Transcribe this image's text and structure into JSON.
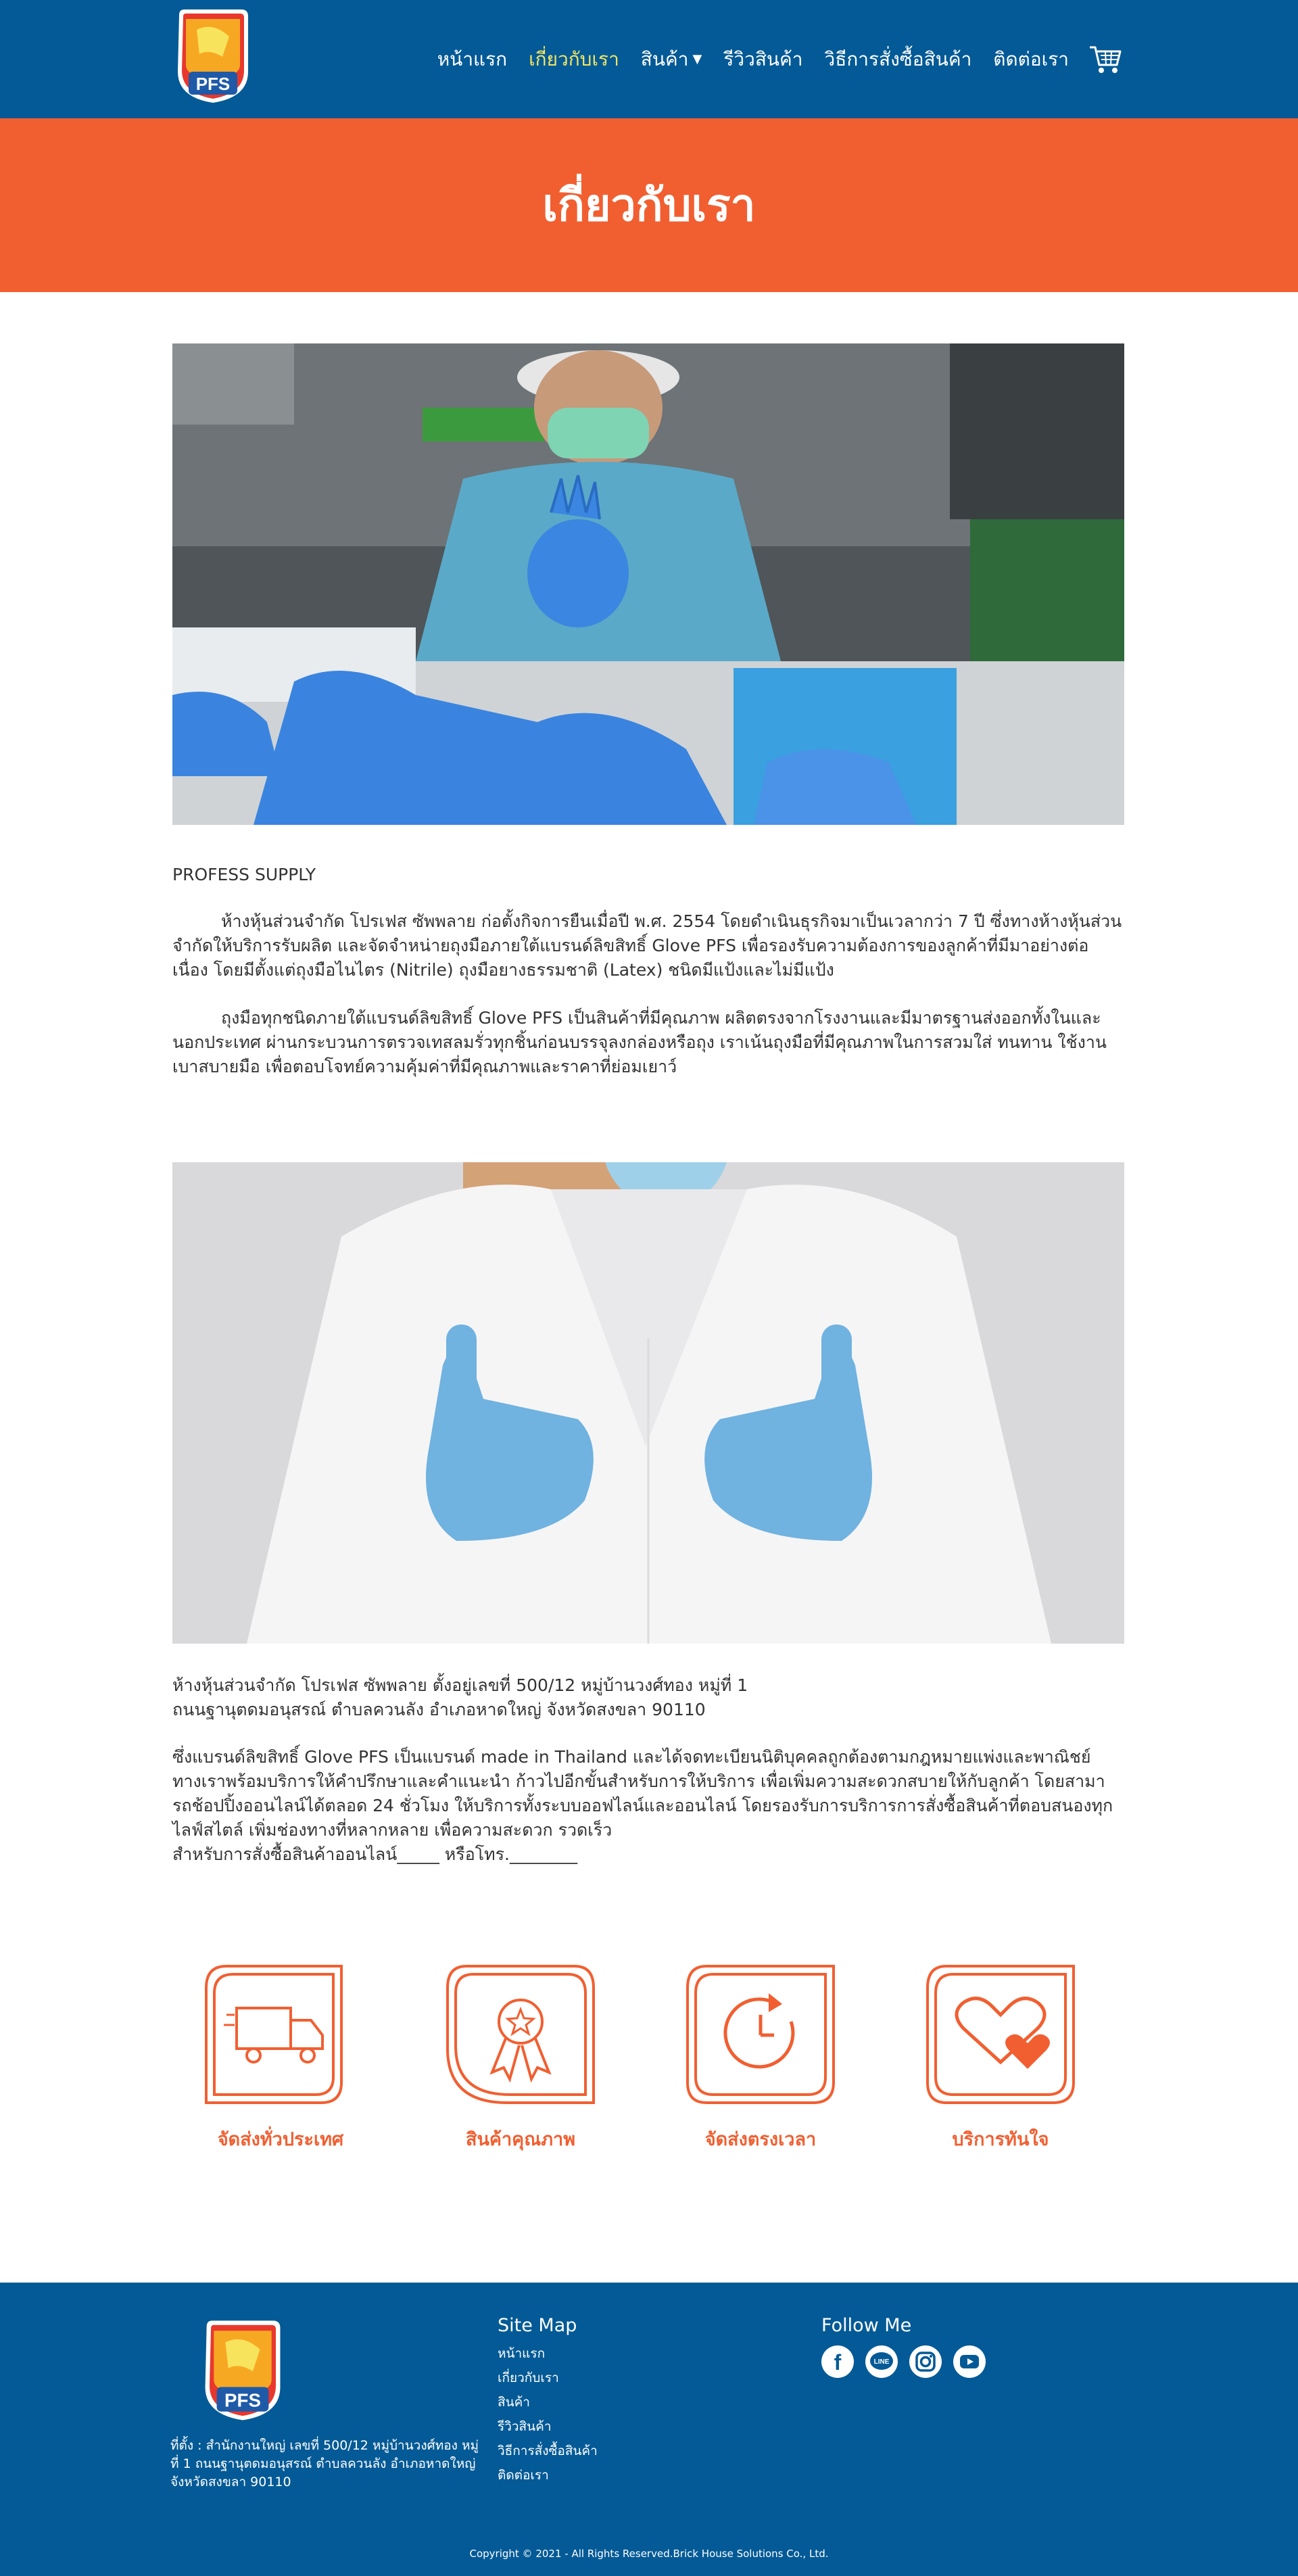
{
  "header": {
    "logo_text": "PFS",
    "nav": [
      {
        "label": "หน้าแรก",
        "active": false
      },
      {
        "label": "เกี่ยวกับเรา",
        "active": true
      },
      {
        "label": "สินค้า",
        "active": false,
        "dropdown": true
      },
      {
        "label": "รีวิวสินค้า",
        "active": false
      },
      {
        "label": "วิธีการสั่งซื้อสินค้า",
        "active": false
      },
      {
        "label": "ติดต่อเรา",
        "active": false
      }
    ],
    "cart_icon": "cart-icon"
  },
  "banner": {
    "title": "เกี่ยวกับเรา"
  },
  "content": {
    "brand_heading": "PROFESS SUPPLY",
    "paragraph1": "ห้างหุ้นส่วนจำกัด โปรเฟส ซัพพลาย ก่อตั้งกิจการยืนเมื่อปี พ.ศ. 2554 โดยดำเนินธุรกิจมาเป็นเวลากว่า 7 ปี ซึ่งทางห้างหุ้นส่วนจำกัดให้บริการรับผลิต และจัดจำหน่ายถุงมือภายใต้แบรนด์ลิขสิทธิ์ Glove PFS เพื่อรองรับความต้องการของลูกค้าที่มีมาอย่างต่อเนื่อง โดยมีตั้งแต่ถุงมือไนไตร (Nitrile) ถุงมือยางธรรมชาติ (Latex) ชนิดมีแป้งและไม่มีแป้ง",
    "paragraph2": "ถุงมือทุกชนิดภายใต้แบรนด์ลิขสิทธิ์ Glove PFS เป็นสินค้าที่มีคุณภาพ ผลิตตรงจากโรงงานและมีมาตรฐานส่งออกทั้งในและนอกประเทศ ผ่านกระบวนการตรวจเทสลมรั่วทุกชิ้นก่อนบรรจุลงกล่องหรือถุง เราเน้นถุงมือที่มีคุณภาพในการสวมใส่ ทนทาน ใช้งานเบาสบายมือ เพื่อตอบโจทย์ความคุ้มค่าที่มีคุณภาพและราคาที่ย่อมเยาว์",
    "address_line1": "ห้างหุ้นส่วนจำกัด โปรเฟส ซัพพลาย ตั้งอยู่เลขที่ 500/12 หมู่บ้านวงศ์ทอง หมู่ที่ 1",
    "address_line2": "ถนนฐานุตดมอนุสรณ์ ตำบลควนลัง อำเภอหาดใหญ่ จังหวัดสงขลา 90110",
    "intro": "ซึ่งแบรนด์ลิขสิทธิ์ Glove PFS เป็นแบรนด์ made in Thailand และได้จดทะเบียนนิติบุคคลถูกต้องตามกฎหมายแพ่งและพาณิชย์ ทางเราพร้อมบริการให้คำปรึกษาและคำแนะนำ ก้าวไปอีกขั้นสำหรับการให้บริการ เพื่อเพิ่มความสะดวกสบายให้กับลูกค้า โดยสามารถช้อปปิ้งออนไลน์ได้ตลอด 24 ชั่วโมง ให้บริการทั้งระบบออฟไลน์และออนไลน์ โดยรองรับการบริการการสั่งซื้อสินค้าที่ตอบสนองทุกไลฟ์สไตล์ เพิ่มช่องทางที่หลากหลาย เพื่อความสะดวก รวดเร็ว",
    "order_line": "สำหรับการสั่งซื้อสินค้าออนไลน์_____ หรือโทร.________"
  },
  "features": [
    {
      "label": "จัดส่งทั่วประเทศ",
      "icon": "truck-icon"
    },
    {
      "label": "สินค้าคุณภาพ",
      "icon": "award-badge-icon"
    },
    {
      "label": "จัดส่งตรงเวลา",
      "icon": "clock-icon"
    },
    {
      "label": "บริการทันใจ",
      "icon": "heart-icon"
    }
  ],
  "footer": {
    "logo_text": "PFS",
    "address": "ที่ตั้ง : สำนักงานใหญ่ เลขที่ 500/12 หมู่บ้านวงศ์ทอง หมู่ที่ 1 ถนนฐานุตดมอนุสรณ์ ตำบลควนลัง อำเภอหาดใหญ่ จังหวัดสงขลา 90110",
    "sitemap_title": "Site Map",
    "sitemap": [
      "หน้าแรก",
      "เกี่ยวกับเรา",
      "สินค้า",
      "รีวิวสินค้า",
      "วิธีการสั่งซื้อสินค้า",
      "ติดต่อเรา"
    ],
    "follow_title": "Follow Me",
    "social": [
      {
        "name": "facebook-icon",
        "glyph": "f"
      },
      {
        "name": "line-icon",
        "glyph": "LINE"
      },
      {
        "name": "instagram-icon",
        "glyph": ""
      },
      {
        "name": "youtube-icon",
        "glyph": ""
      }
    ],
    "copyright": "Copyright © 2021 -  All Rights Reserved.Brick House Solutions Co., Ltd."
  },
  "colors": {
    "header_blue": "#045a96",
    "banner_orange": "#f15f31",
    "active_nav": "#f5e663"
  }
}
